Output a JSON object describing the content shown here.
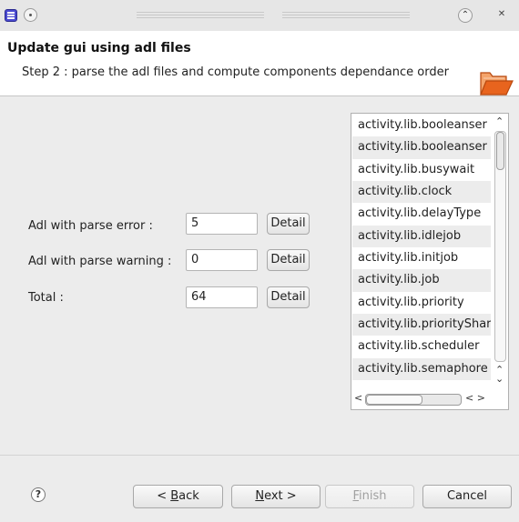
{
  "window": {
    "icons": {
      "app": "eclipse-app-icon",
      "sticky": "sticky-icon",
      "maximize": "maximize-icon",
      "close": "close-icon"
    },
    "maximize_glyph": "⌃",
    "close_glyph": "✕"
  },
  "header": {
    "title": "Update gui using adl files",
    "subtitle": "Step 2 : parse the adl files and compute components dependance order",
    "banner_icon": "open-folder-icon"
  },
  "form": {
    "rows": [
      {
        "label": "Adl with parse error  :",
        "value": "5",
        "button": "Detail"
      },
      {
        "label": "Adl with parse warning  :",
        "value": "0",
        "button": "Detail"
      },
      {
        "label": "Total :",
        "value": "64",
        "button": "Detail"
      }
    ]
  },
  "components_list": {
    "items": [
      "activity.lib.booleanser",
      "activity.lib.booleanser",
      "activity.lib.busywait",
      "activity.lib.clock",
      "activity.lib.delayType",
      "activity.lib.idlejob",
      "activity.lib.initjob",
      "activity.lib.job",
      "activity.lib.priority",
      "activity.lib.priorityShar",
      "activity.lib.scheduler",
      "activity.lib.semaphore"
    ],
    "scroll_fraction": 0.0
  },
  "footer": {
    "help_glyph": "?",
    "back": {
      "prefix": "< ",
      "mnemonic": "B",
      "rest": "ack"
    },
    "next": {
      "mnemonic": "N",
      "rest": "ext >"
    },
    "finish": {
      "mnemonic": "F",
      "rest": "inish"
    },
    "cancel": "Cancel"
  },
  "colors": {
    "window_bg": "#ececec",
    "header_bg": "#ffffff",
    "folder_icon": "#e8641e"
  }
}
